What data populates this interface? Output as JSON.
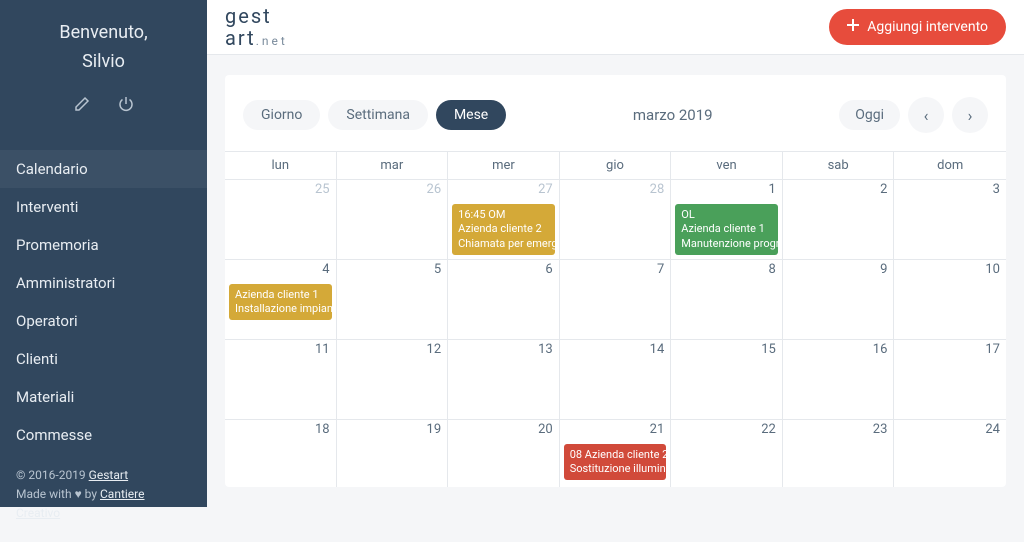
{
  "sidebar": {
    "welcome_label": "Benvenuto,",
    "user_name": "Silvio",
    "items": [
      {
        "label": "Calendario"
      },
      {
        "label": "Interventi"
      },
      {
        "label": "Promemoria"
      },
      {
        "label": "Amministratori"
      },
      {
        "label": "Operatori"
      },
      {
        "label": "Clienti"
      },
      {
        "label": "Materiali"
      },
      {
        "label": "Commesse"
      }
    ],
    "footer_copyright": "© 2016-2019 ",
    "footer_brand": "Gestart",
    "footer_made": "Made with ",
    "footer_heart": "♥",
    "footer_by": " by ",
    "footer_author": "Cantiere Creativo"
  },
  "logo": {
    "line1": "gest",
    "line2": "art",
    "suffix": ".net"
  },
  "topbar": {
    "add_button": "Aggiungi intervento"
  },
  "calendar": {
    "tabs": {
      "day": "Giorno",
      "week": "Settimana",
      "month": "Mese"
    },
    "title": "marzo 2019",
    "today": "Oggi",
    "dow": [
      "lun",
      "mar",
      "mer",
      "gio",
      "ven",
      "sab",
      "dom"
    ],
    "weeks": [
      [
        "25",
        "26",
        "27",
        "28",
        "1",
        "2",
        "3"
      ],
      [
        "4",
        "5",
        "6",
        "7",
        "8",
        "9",
        "10"
      ],
      [
        "11",
        "12",
        "13",
        "14",
        "15",
        "16",
        "17"
      ],
      [
        "18",
        "19",
        "20",
        "21",
        "22",
        "23",
        "24"
      ]
    ],
    "other_month": [
      [
        0,
        1,
        2,
        3
      ],
      [],
      [],
      []
    ],
    "events": {
      "w0d2": {
        "color": "yellow",
        "line1": "16:45 OM",
        "line2": "Azienda cliente 2",
        "line3": "Chiamata per emerg"
      },
      "w0d4": {
        "color": "green",
        "line1": "OL",
        "line2": "Azienda cliente 1",
        "line3": "Manutenzione progr"
      },
      "w1d0": {
        "color": "yellow",
        "line1": "Azienda cliente 1",
        "line2": "Installazione impian",
        "line3": ""
      },
      "w3d3": {
        "color": "red",
        "line1": "08 Azienda cliente 2",
        "line2": "Sostituzione illumin",
        "line3": ""
      }
    }
  }
}
